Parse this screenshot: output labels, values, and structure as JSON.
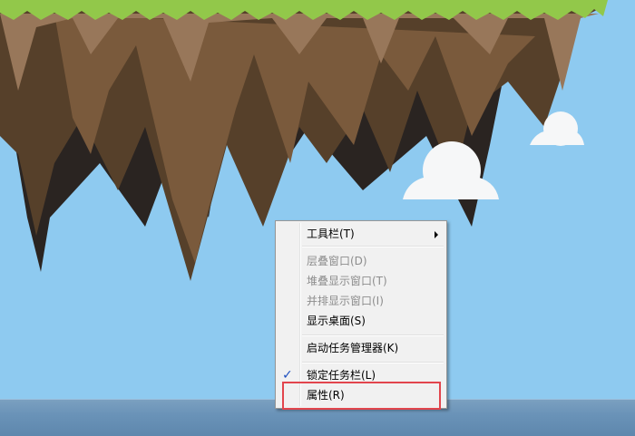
{
  "colors": {
    "sky": "#8ecaf0",
    "grass": "#92c84a",
    "earth_dark": "#56402a",
    "earth_mid": "#7a5a3c",
    "earth_light": "#98775a",
    "shadow": "#2a2421",
    "cloud": "#f6f7f8",
    "highlight": "#e2454d",
    "check": "#1d4fbf"
  },
  "context_menu": {
    "items": [
      {
        "label": "工具栏(T)",
        "enabled": true,
        "submenu": true
      },
      {
        "label": "层叠窗口(D)",
        "enabled": false
      },
      {
        "label": "堆叠显示窗口(T)",
        "enabled": false
      },
      {
        "label": "并排显示窗口(I)",
        "enabled": false
      },
      {
        "label": "显示桌面(S)",
        "enabled": true
      },
      {
        "label": "启动任务管理器(K)",
        "enabled": true
      },
      {
        "label": "锁定任务栏(L)",
        "enabled": true,
        "checked": true
      },
      {
        "label": "属性(R)",
        "enabled": true
      }
    ]
  },
  "icons": {
    "submenu_arrow": "chevron-right-icon",
    "check": "checkmark-icon"
  }
}
